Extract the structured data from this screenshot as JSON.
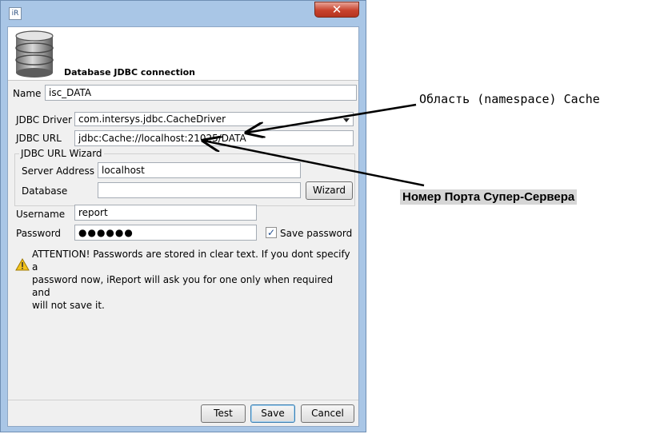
{
  "window": {
    "app_icon_glyph": "iR",
    "close_glyph": "✕"
  },
  "header": {
    "title": "Database JDBC connection"
  },
  "form": {
    "name_label": "Name",
    "name_value": "isc_DATA",
    "jdbc_driver_label": "JDBC Driver",
    "jdbc_driver_value": "com.intersys.jdbc.CacheDriver",
    "jdbc_url_label": "JDBC URL",
    "jdbc_url_value": "jdbc:Cache://localhost:21025/DATA",
    "wizard_group_title": "JDBC URL Wizard",
    "server_address_label": "Server Address",
    "server_address_value": "localhost",
    "database_label": "Database",
    "database_value": "",
    "wizard_button": "Wizard",
    "username_label": "Username",
    "username_value": "report",
    "password_label": "Password",
    "password_value": "●●●●●●",
    "save_password_label": "Save password",
    "save_password_checked": true,
    "attention_text": "ATTENTION! Passwords are stored in clear text. If you dont specify a\npassword now, iReport will ask you for one only when required and\nwill not save it."
  },
  "footer": {
    "test_button": "Test",
    "save_button": "Save",
    "cancel_button": "Cancel"
  },
  "annotations": {
    "namespace_note": "Область (namespace) Cache",
    "port_note": "Номер Порта Супер-Сервера"
  },
  "icons": [
    "app-icon",
    "close-icon",
    "database-icon",
    "chevron-down-icon",
    "checkmark-icon",
    "warning-icon"
  ],
  "colors": {
    "window_frame": "#a9c6e6",
    "close_button": "#c8432d",
    "dialog_bg": "#f0f0f0",
    "warning": "#f2c21b",
    "annotation_bg": "#d6d6d6"
  }
}
